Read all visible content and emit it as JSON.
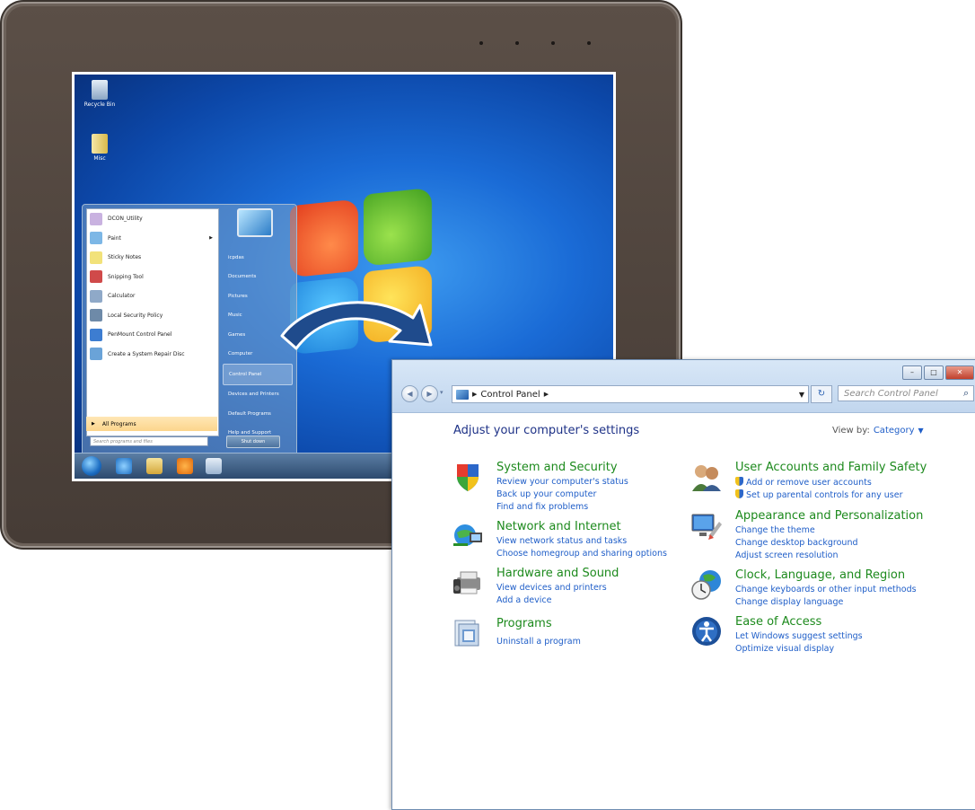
{
  "desktop": {
    "icons": [
      {
        "label": "Recycle Bin",
        "icon": "recycle-bin-icon"
      },
      {
        "label": "Misc",
        "icon": "folder-icon"
      }
    ],
    "start_menu": {
      "programs": [
        {
          "label": "DCON_Utility",
          "icon": "dcon-utility-icon",
          "color": "#c9b2e0"
        },
        {
          "label": "Paint",
          "icon": "paint-icon",
          "color": "#7db7e6"
        },
        {
          "label": "Sticky Notes",
          "icon": "sticky-notes-icon",
          "color": "#f2e27a"
        },
        {
          "label": "Snipping Tool",
          "icon": "snipping-tool-icon",
          "color": "#d04a4a"
        },
        {
          "label": "Calculator",
          "icon": "calculator-icon",
          "color": "#8fa9c8"
        },
        {
          "label": "Local Security Policy",
          "icon": "security-policy-icon",
          "color": "#6e8aa8"
        },
        {
          "label": "PenMount Control Panel",
          "icon": "penmount-icon",
          "color": "#3d7dd1"
        },
        {
          "label": "Create a System Repair Disc",
          "icon": "repair-disc-icon",
          "color": "#6aa3d8"
        }
      ],
      "all_programs": "All Programs",
      "search_placeholder": "Search programs and files",
      "right_items": [
        "icpdas",
        "Documents",
        "Pictures",
        "Music",
        "Games",
        "Computer",
        "Control Panel",
        "Devices and Printers",
        "Default Programs",
        "Help and Support"
      ],
      "selected_right": "Control Panel",
      "shutdown": "Shut down"
    }
  },
  "control_panel": {
    "breadcrumb": [
      "Control Panel"
    ],
    "search_placeholder": "Search Control Panel",
    "heading": "Adjust your computer's settings",
    "view_by_label": "View by:",
    "view_by_value": "Category",
    "categories_left": [
      {
        "title": "System and Security",
        "icon": "system-security-icon",
        "links": [
          "Review your computer's status",
          "Back up your computer",
          "Find and fix problems"
        ]
      },
      {
        "title": "Network and Internet",
        "icon": "network-internet-icon",
        "links": [
          "View network status and tasks",
          "Choose homegroup and sharing options"
        ]
      },
      {
        "title": "Hardware and Sound",
        "icon": "hardware-sound-icon",
        "links": [
          "View devices and printers",
          "Add a device"
        ]
      },
      {
        "title": "Programs",
        "icon": "programs-icon",
        "links": [
          "Uninstall a program"
        ]
      }
    ],
    "categories_right": [
      {
        "title": "User Accounts and Family Safety",
        "icon": "user-accounts-icon",
        "links": [
          "Add or remove user accounts",
          "Set up parental controls for any user"
        ]
      },
      {
        "title": "Appearance and Personalization",
        "icon": "appearance-icon",
        "links": [
          "Change the theme",
          "Change desktop background",
          "Adjust screen resolution"
        ]
      },
      {
        "title": "Clock, Language, and Region",
        "icon": "clock-language-icon",
        "links": [
          "Change keyboards or other input methods",
          "Change display language"
        ]
      },
      {
        "title": "Ease of Access",
        "icon": "ease-of-access-icon",
        "links": [
          "Let Windows suggest settings",
          "Optimize visual display"
        ]
      }
    ]
  }
}
